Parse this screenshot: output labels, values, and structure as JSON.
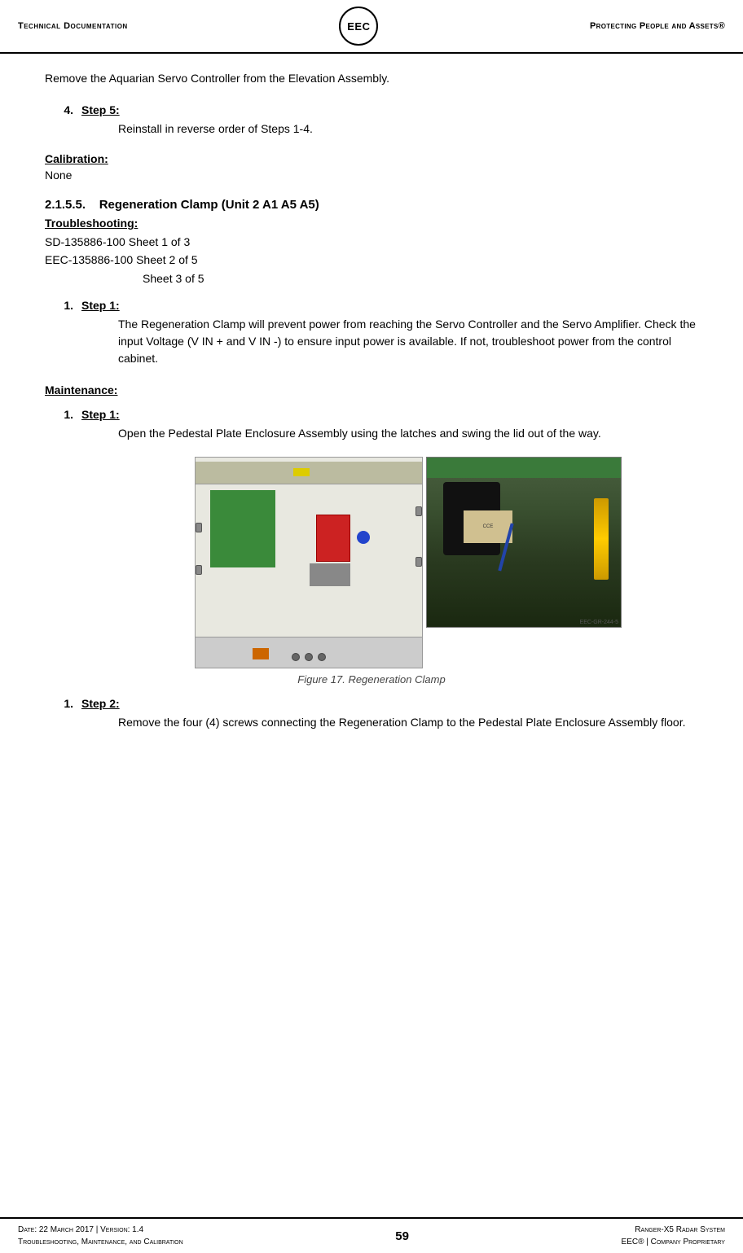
{
  "header": {
    "left": "Technical Documentation",
    "logo": "EEC",
    "right": "Protecting People and Assets®"
  },
  "intro": {
    "text": "Remove the Aquarian Servo Controller from the Elevation Assembly."
  },
  "step4": {
    "number": "4.",
    "title": "Step 5:",
    "body": "Reinstall in reverse order of Steps 1-4."
  },
  "calibration": {
    "label": "Calibration:",
    "value": "None"
  },
  "section": {
    "heading": "2.1.5.5.    Regeneration Clamp (Unit 2 A1 A5 A5)"
  },
  "troubleshooting": {
    "label": "Troubleshooting:",
    "line1": "SD-135886-100 Sheet 1 of 3",
    "line2": "EEC-135886-100 Sheet 2 of 5",
    "line3": "Sheet 3 of 5"
  },
  "step1_trouble": {
    "number": "1.",
    "title": "Step 1:",
    "body": "The Regeneration Clamp will prevent power from reaching the Servo Controller and the Servo Amplifier.  Check the input Voltage (V IN + and V IN -) to ensure input power is available.  If not, troubleshoot power from the control cabinet."
  },
  "maintenance": {
    "label": "Maintenance:"
  },
  "step1_maint": {
    "number": "1.",
    "title": "Step 1",
    "colon": ":",
    "body": "Open the Pedestal Plate Enclosure Assembly using the latches and swing the lid out of the way."
  },
  "figure": {
    "caption": "Figure 17. Regeneration Clamp",
    "eec_label": "EEC-GR-244-5"
  },
  "step2": {
    "number": "1.",
    "title": "Step 2:",
    "body": "Remove the four (4) screws connecting the Regeneration Clamp to the Pedestal Plate Enclosure Assembly floor."
  },
  "footer": {
    "left_line1": "Date: 22 March 2017 | Version: 1.4",
    "left_line2": "Troubleshooting, Maintenance, and Calibration",
    "page": "59",
    "right_line1": "Ranger-X5 Radar System",
    "right_line2": "EEC® | Company Proprietary"
  }
}
